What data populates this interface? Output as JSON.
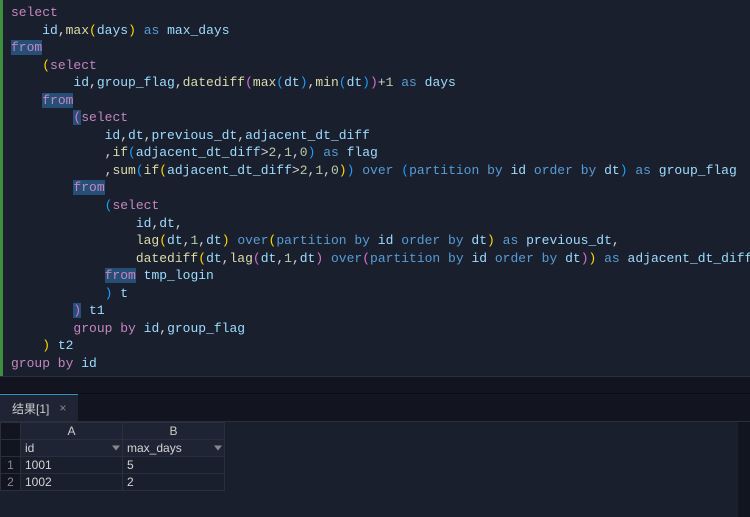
{
  "sql": {
    "tokens": [
      [
        {
          "t": "select",
          "c": "kw"
        }
      ],
      [
        {
          "t": "    id",
          "c": "id"
        },
        {
          "t": ",",
          "c": "op"
        },
        {
          "t": "max",
          "c": "fn"
        },
        {
          "t": "(",
          "c": "paren"
        },
        {
          "t": "days",
          "c": "id"
        },
        {
          "t": ")",
          "c": "paren"
        },
        {
          "t": " ",
          "c": "op"
        },
        {
          "t": "as",
          "c": "as"
        },
        {
          "t": " max_days",
          "c": "id"
        }
      ],
      [
        {
          "t": "from",
          "c": "kw",
          "bg": "sel"
        }
      ],
      [
        {
          "t": "    ",
          "c": "op"
        },
        {
          "t": "(",
          "c": "paren"
        },
        {
          "t": "select",
          "c": "kw"
        }
      ],
      [
        {
          "t": "        id",
          "c": "id"
        },
        {
          "t": ",",
          "c": "op"
        },
        {
          "t": "group_flag",
          "c": "id"
        },
        {
          "t": ",",
          "c": "op"
        },
        {
          "t": "datediff",
          "c": "fn"
        },
        {
          "t": "(",
          "c": "paren2"
        },
        {
          "t": "max",
          "c": "fn"
        },
        {
          "t": "(",
          "c": "paren3"
        },
        {
          "t": "dt",
          "c": "id"
        },
        {
          "t": ")",
          "c": "paren3"
        },
        {
          "t": ",",
          "c": "op"
        },
        {
          "t": "min",
          "c": "fn"
        },
        {
          "t": "(",
          "c": "paren3"
        },
        {
          "t": "dt",
          "c": "id"
        },
        {
          "t": ")",
          "c": "paren3"
        },
        {
          "t": ")",
          "c": "paren2"
        },
        {
          "t": "+",
          "c": "op"
        },
        {
          "t": "1",
          "c": "num"
        },
        {
          "t": " ",
          "c": "op"
        },
        {
          "t": "as",
          "c": "as"
        },
        {
          "t": " days",
          "c": "id"
        }
      ],
      [
        {
          "t": "    ",
          "c": "op"
        },
        {
          "t": "from",
          "c": "kw",
          "bg": "sel"
        }
      ],
      [
        {
          "t": "        ",
          "c": "op"
        },
        {
          "t": "(",
          "c": "paren2",
          "bg": "sel"
        },
        {
          "t": "select",
          "c": "kw"
        }
      ],
      [
        {
          "t": "            id",
          "c": "id"
        },
        {
          "t": ",",
          "c": "op"
        },
        {
          "t": "dt",
          "c": "id"
        },
        {
          "t": ",",
          "c": "op"
        },
        {
          "t": "previous_dt",
          "c": "id"
        },
        {
          "t": ",",
          "c": "op"
        },
        {
          "t": "adjacent_dt_diff",
          "c": "id"
        }
      ],
      [
        {
          "t": "            ",
          "c": "op"
        },
        {
          "t": ",",
          "c": "op"
        },
        {
          "t": "if",
          "c": "fn"
        },
        {
          "t": "(",
          "c": "paren3"
        },
        {
          "t": "adjacent_dt_diff",
          "c": "id"
        },
        {
          "t": ">",
          "c": "op"
        },
        {
          "t": "2",
          "c": "num"
        },
        {
          "t": ",",
          "c": "op"
        },
        {
          "t": "1",
          "c": "num"
        },
        {
          "t": ",",
          "c": "op"
        },
        {
          "t": "0",
          "c": "num"
        },
        {
          "t": ")",
          "c": "paren3"
        },
        {
          "t": " ",
          "c": "op"
        },
        {
          "t": "as",
          "c": "as"
        },
        {
          "t": " flag",
          "c": "id"
        }
      ],
      [
        {
          "t": "            ",
          "c": "op"
        },
        {
          "t": ",",
          "c": "op"
        },
        {
          "t": "sum",
          "c": "fn"
        },
        {
          "t": "(",
          "c": "paren3"
        },
        {
          "t": "if",
          "c": "fn"
        },
        {
          "t": "(",
          "c": "paren"
        },
        {
          "t": "adjacent_dt_diff",
          "c": "id"
        },
        {
          "t": ">",
          "c": "op"
        },
        {
          "t": "2",
          "c": "num"
        },
        {
          "t": ",",
          "c": "op"
        },
        {
          "t": "1",
          "c": "num"
        },
        {
          "t": ",",
          "c": "op"
        },
        {
          "t": "0",
          "c": "num"
        },
        {
          "t": ")",
          "c": "paren"
        },
        {
          "t": ")",
          "c": "paren3"
        },
        {
          "t": " ",
          "c": "op"
        },
        {
          "t": "over",
          "c": "as"
        },
        {
          "t": " ",
          "c": "op"
        },
        {
          "t": "(",
          "c": "paren3"
        },
        {
          "t": "partition by",
          "c": "as"
        },
        {
          "t": " id ",
          "c": "id"
        },
        {
          "t": "order by",
          "c": "as"
        },
        {
          "t": " dt",
          "c": "id"
        },
        {
          "t": ")",
          "c": "paren3"
        },
        {
          "t": " ",
          "c": "op"
        },
        {
          "t": "as",
          "c": "as"
        },
        {
          "t": " group_flag",
          "c": "id"
        }
      ],
      [
        {
          "t": "        ",
          "c": "op"
        },
        {
          "t": "from",
          "c": "kw",
          "bg": "sel"
        }
      ],
      [
        {
          "t": "            ",
          "c": "op"
        },
        {
          "t": "(",
          "c": "paren3"
        },
        {
          "t": "select",
          "c": "kw"
        }
      ],
      [
        {
          "t": "                id",
          "c": "id"
        },
        {
          "t": ",",
          "c": "op"
        },
        {
          "t": "dt",
          "c": "id"
        },
        {
          "t": ",",
          "c": "op"
        }
      ],
      [
        {
          "t": "                ",
          "c": "op"
        },
        {
          "t": "lag",
          "c": "fn"
        },
        {
          "t": "(",
          "c": "paren"
        },
        {
          "t": "dt",
          "c": "id"
        },
        {
          "t": ",",
          "c": "op"
        },
        {
          "t": "1",
          "c": "num"
        },
        {
          "t": ",",
          "c": "op"
        },
        {
          "t": "dt",
          "c": "id"
        },
        {
          "t": ")",
          "c": "paren"
        },
        {
          "t": " ",
          "c": "op"
        },
        {
          "t": "over",
          "c": "as"
        },
        {
          "t": "(",
          "c": "paren"
        },
        {
          "t": "partition by",
          "c": "as"
        },
        {
          "t": " id ",
          "c": "id"
        },
        {
          "t": "order by",
          "c": "as"
        },
        {
          "t": " dt",
          "c": "id"
        },
        {
          "t": ")",
          "c": "paren"
        },
        {
          "t": " ",
          "c": "op"
        },
        {
          "t": "as",
          "c": "as"
        },
        {
          "t": " previous_dt",
          "c": "id"
        },
        {
          "t": ",",
          "c": "op"
        }
      ],
      [
        {
          "t": "                ",
          "c": "op"
        },
        {
          "t": "datediff",
          "c": "fn"
        },
        {
          "t": "(",
          "c": "paren"
        },
        {
          "t": "dt",
          "c": "id"
        },
        {
          "t": ",",
          "c": "op"
        },
        {
          "t": "lag",
          "c": "fn"
        },
        {
          "t": "(",
          "c": "paren2"
        },
        {
          "t": "dt",
          "c": "id"
        },
        {
          "t": ",",
          "c": "op"
        },
        {
          "t": "1",
          "c": "num"
        },
        {
          "t": ",",
          "c": "op"
        },
        {
          "t": "dt",
          "c": "id"
        },
        {
          "t": ")",
          "c": "paren2"
        },
        {
          "t": " ",
          "c": "op"
        },
        {
          "t": "over",
          "c": "as"
        },
        {
          "t": "(",
          "c": "paren2"
        },
        {
          "t": "partition by",
          "c": "as"
        },
        {
          "t": " id ",
          "c": "id"
        },
        {
          "t": "order by",
          "c": "as"
        },
        {
          "t": " dt",
          "c": "id"
        },
        {
          "t": ")",
          "c": "paren2"
        },
        {
          "t": ")",
          "c": "paren"
        },
        {
          "t": " ",
          "c": "op"
        },
        {
          "t": "as",
          "c": "as"
        },
        {
          "t": " adjacent_dt_diff",
          "c": "id"
        }
      ],
      [
        {
          "t": "            ",
          "c": "op"
        },
        {
          "t": "from",
          "c": "kw",
          "bg": "sel"
        },
        {
          "t": " tmp_login",
          "c": "id"
        }
      ],
      [
        {
          "t": "            ",
          "c": "op"
        },
        {
          "t": ")",
          "c": "paren3"
        },
        {
          "t": " t",
          "c": "id"
        }
      ],
      [
        {
          "t": "        ",
          "c": "op"
        },
        {
          "t": ")",
          "c": "paren2",
          "bg": "sel"
        },
        {
          "t": " t1",
          "c": "id"
        }
      ],
      [
        {
          "t": "        ",
          "c": "op"
        },
        {
          "t": "group by",
          "c": "kw"
        },
        {
          "t": " id",
          "c": "id"
        },
        {
          "t": ",",
          "c": "op"
        },
        {
          "t": "group_flag",
          "c": "id"
        }
      ],
      [
        {
          "t": "    ",
          "c": "op"
        },
        {
          "t": ")",
          "c": "paren"
        },
        {
          "t": " t2",
          "c": "id"
        }
      ],
      [
        {
          "t": "group by",
          "c": "kw"
        },
        {
          "t": " id",
          "c": "id"
        }
      ]
    ]
  },
  "results": {
    "tab_label": "结果[1]",
    "columns_letters": [
      "A",
      "B"
    ],
    "columns": [
      "id",
      "max_days"
    ],
    "rows": [
      {
        "n": "1",
        "cells": [
          "1001",
          "5"
        ]
      },
      {
        "n": "2",
        "cells": [
          "1002",
          "2"
        ]
      }
    ]
  }
}
